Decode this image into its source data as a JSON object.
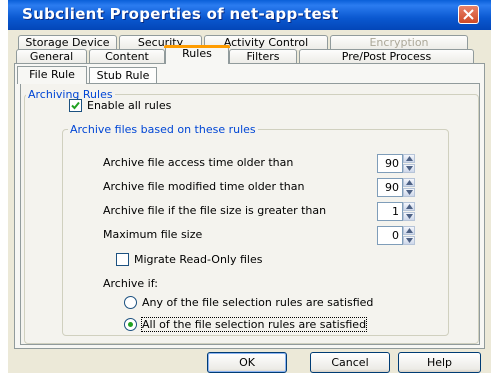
{
  "window": {
    "title": "Subclient Properties of net-app-test",
    "close_icon": "close-icon"
  },
  "tabs_row1": [
    {
      "label": "Storage Device",
      "disabled": false
    },
    {
      "label": "Security",
      "disabled": false
    },
    {
      "label": "Activity Control",
      "disabled": false
    },
    {
      "label": "Encryption",
      "disabled": true
    }
  ],
  "tabs_row2": [
    {
      "label": "General"
    },
    {
      "label": "Content"
    },
    {
      "label": "Rules",
      "active": true
    },
    {
      "label": "Filters"
    },
    {
      "label": "Pre/Post Process"
    }
  ],
  "subtabs": [
    {
      "label": "File Rule",
      "active": true
    },
    {
      "label": "Stub Rule",
      "active": false
    }
  ],
  "archiving_rules": {
    "legend": "Archiving Rules",
    "enable_all": {
      "label": "Enable all rules",
      "checked": true
    },
    "based_on": {
      "legend": "Archive files based on these rules",
      "rows": [
        {
          "label": "Archive file access time older than",
          "value": "90"
        },
        {
          "label": "Archive file modified time older than",
          "value": "90"
        },
        {
          "label": "Archive file if the file size is greater than",
          "value": "1"
        },
        {
          "label": "Maximum file size",
          "value": "0"
        }
      ],
      "migrate_readonly": {
        "label": "Migrate Read-Only files",
        "checked": false
      },
      "archive_if_label": "Archive if:",
      "options": [
        {
          "label": "Any of the file selection rules are satisfied",
          "selected": false
        },
        {
          "label": "All of the file selection rules are satisfied",
          "selected": true
        }
      ]
    }
  },
  "buttons": {
    "ok": "OK",
    "cancel": "Cancel",
    "help": "Help"
  },
  "colors": {
    "titlebar": "#0a58d0",
    "legend": "#0046d5",
    "radio_dot": "#21a121",
    "tab_highlight": "#ff9c00"
  }
}
